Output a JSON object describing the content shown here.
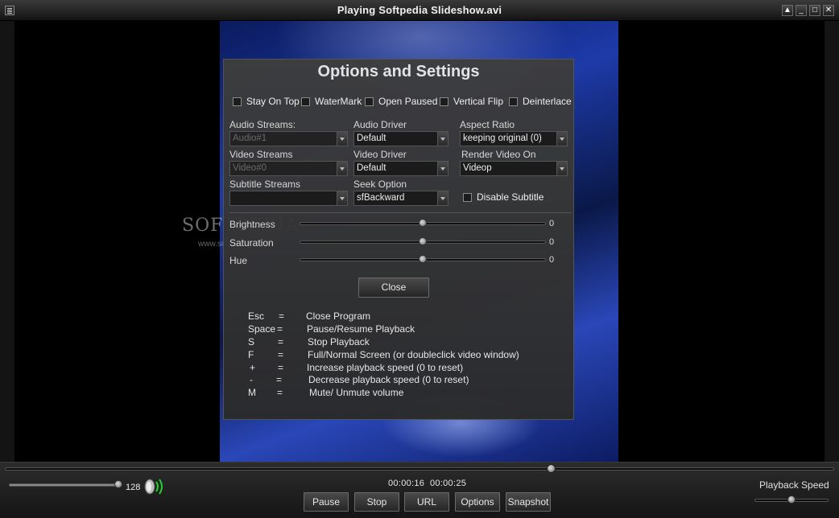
{
  "window": {
    "title": "Playing Softpedia Slideshow.avi",
    "buttons": [
      "▲",
      "_",
      "□",
      "✕"
    ]
  },
  "watermark": {
    "logo": "SOFTPEDIA",
    "url": "www.softpedia.com"
  },
  "dialog": {
    "title": "Options and Settings",
    "checkboxes": [
      {
        "label": "Stay On Top",
        "checked": false
      },
      {
        "label": "WaterMark",
        "checked": false
      },
      {
        "label": "Open Paused",
        "checked": false
      },
      {
        "label": "Vertical Flip",
        "checked": false
      },
      {
        "label": "Deinterlace",
        "checked": false
      }
    ],
    "fields": {
      "audio_streams": {
        "label": "Audio Streams:",
        "value": "Audio#1"
      },
      "audio_driver": {
        "label": "Audio Driver",
        "value": "Default"
      },
      "aspect_ratio": {
        "label": "Aspect Ratio",
        "value": "keeping original (0)"
      },
      "video_streams": {
        "label": "Video Streams",
        "value": "Video#0"
      },
      "video_driver": {
        "label": "Video Driver",
        "value": "Default"
      },
      "render_video_on": {
        "label": "Render Video On",
        "value": "Videop"
      },
      "subtitle_streams": {
        "label": "Subtitle Streams",
        "value": ""
      },
      "seek_option": {
        "label": "Seek Option",
        "value": "sfBackward"
      }
    },
    "disable_subtitle": {
      "label": "Disable Subtitle",
      "checked": false
    },
    "sliders": [
      {
        "label": "Brightness",
        "value": "0",
        "level": 0.5
      },
      {
        "label": "Saturation",
        "value": "0",
        "level": 0.5
      },
      {
        "label": "Hue",
        "value": "0",
        "level": 0.5
      }
    ],
    "close_label": "Close",
    "shortcuts": [
      {
        "key": "Esc",
        "eq": "=",
        "action": "Close Program"
      },
      {
        "key": "Space",
        "eq": "=",
        "action": "Pause/Resume Playback"
      },
      {
        "key": "S",
        "eq": "=",
        "action": "Stop Playback"
      },
      {
        "key": "F",
        "eq": "=",
        "action": "Full/Normal Screen (or doubleclick video window)"
      },
      {
        "key": "+",
        "eq": "=",
        "action": "Increase playback speed (0 to reset)"
      },
      {
        "key": "-",
        "eq": "=",
        "action": "Decrease playback speed (0 to reset)"
      },
      {
        "key": "M",
        "eq": "=",
        "action": "Mute/ Unmute volume"
      }
    ]
  },
  "controls": {
    "seek_progress": 0.66,
    "volume": "128",
    "volume_level": 1.0,
    "time_current": "00:00:16",
    "time_total": "00:00:25",
    "buttons": [
      "Pause",
      "Stop",
      "URL",
      "Options",
      "Snapshot"
    ],
    "playback_speed_label": "Playback Speed",
    "playback_speed_level": 0.5
  }
}
